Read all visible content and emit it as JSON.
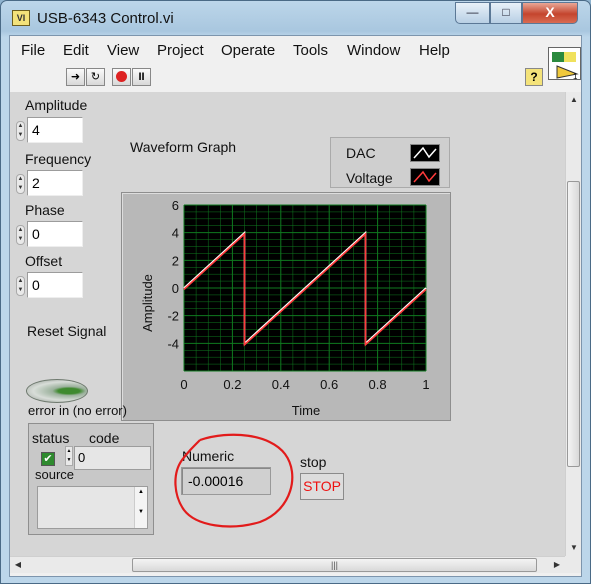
{
  "window": {
    "title": "USB-6343 Control.vi",
    "buttons": {
      "minimize": "—",
      "maximize": "□",
      "close": "X"
    }
  },
  "menu": [
    "File",
    "Edit",
    "View",
    "Project",
    "Operate",
    "Tools",
    "Window",
    "Help"
  ],
  "toolbar": {
    "icons": [
      "run-arrow-icon",
      "run-continuously-icon",
      "abort-icon",
      "pause-icon"
    ],
    "help": "?"
  },
  "controls": {
    "amplitude": {
      "label": "Amplitude",
      "value": "4"
    },
    "frequency": {
      "label": "Frequency",
      "value": "2"
    },
    "phase": {
      "label": "Phase",
      "value": "0"
    },
    "offset": {
      "label": "Offset",
      "value": "0"
    },
    "reset": {
      "label": "Reset Signal"
    }
  },
  "legend": [
    {
      "name": "DAC",
      "color": "#ffffff"
    },
    {
      "name": "Voltage",
      "color": "#ff3b3b"
    }
  ],
  "graph": {
    "label": "Waveform Graph"
  },
  "chart_data": {
    "type": "line",
    "title": "Waveform Graph",
    "xlabel": "Time",
    "ylabel": "Amplitude",
    "xlim": [
      0,
      1
    ],
    "ylim": [
      -6,
      6
    ],
    "xticks": [
      "0",
      "0.2",
      "0.4",
      "0.6",
      "0.8",
      "1"
    ],
    "yticks": [
      "6",
      "4",
      "2",
      "0",
      "-2",
      "-4"
    ],
    "grid": true,
    "series": [
      {
        "name": "DAC",
        "color": "#ffffff",
        "x": [
          0,
          0.25,
          0.25,
          0.75,
          0.75,
          1
        ],
        "y": [
          0,
          4,
          -4,
          4,
          -4,
          0
        ]
      },
      {
        "name": "Voltage",
        "color": "#ff3b3b",
        "x": [
          0,
          0.25,
          0.25,
          0.75,
          0.75,
          1
        ],
        "y": [
          -0.1,
          3.9,
          -4.1,
          3.9,
          -4.1,
          -0.1
        ]
      }
    ]
  },
  "error_in": {
    "label": "error in (no error)",
    "status_label": "status",
    "code_label": "code",
    "code_value": "0",
    "source_label": "source",
    "status_check": "✔"
  },
  "numeric": {
    "label": "Numeric",
    "value": "-0.00016"
  },
  "stop": {
    "label": "stop",
    "button": "STOP"
  },
  "colors": {
    "plot_bg": "#000000",
    "grid": "#0f7a1f",
    "annotation": "#e21b1b",
    "stop_text": "#e11111"
  }
}
